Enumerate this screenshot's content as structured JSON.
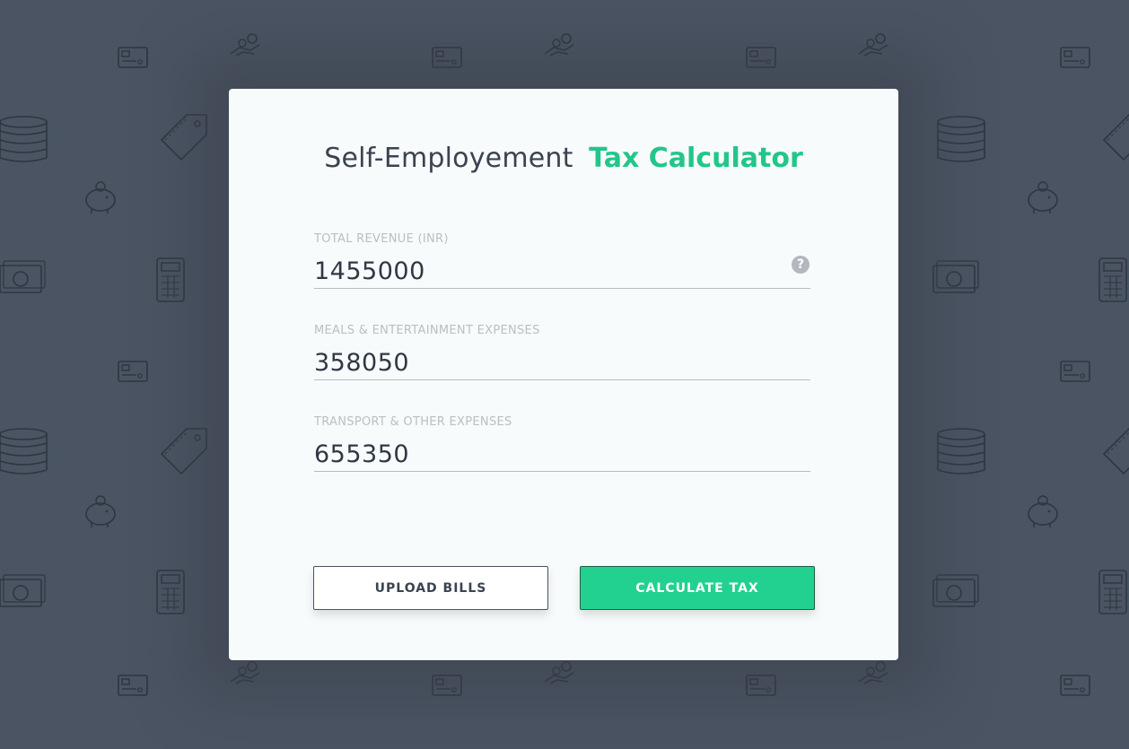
{
  "title": {
    "prefix": "Self-Employement",
    "highlight": "Tax Calculator"
  },
  "fields": [
    {
      "label": "TOTAL REVENUE (INR)",
      "value": "1455000",
      "help_icon": "question-circle-icon"
    },
    {
      "label": "MEALS & ENTERTAINMENT EXPENSES",
      "value": "358050"
    },
    {
      "label": "TRANSPORT & OTHER EXPENSES",
      "value": "655350"
    }
  ],
  "buttons": {
    "upload": "UPLOAD BILLS",
    "calculate": "CALCULATE TAX"
  },
  "background_icons": [
    "credit-card-icon",
    "coin-hand-icon",
    "coin-stack-icon",
    "price-tag-icon",
    "piggy-bank-icon",
    "banknote-icon",
    "calculator-icon"
  ],
  "colors": {
    "background": "#4a5462",
    "accent": "#22d190",
    "text": "#3a4350"
  }
}
